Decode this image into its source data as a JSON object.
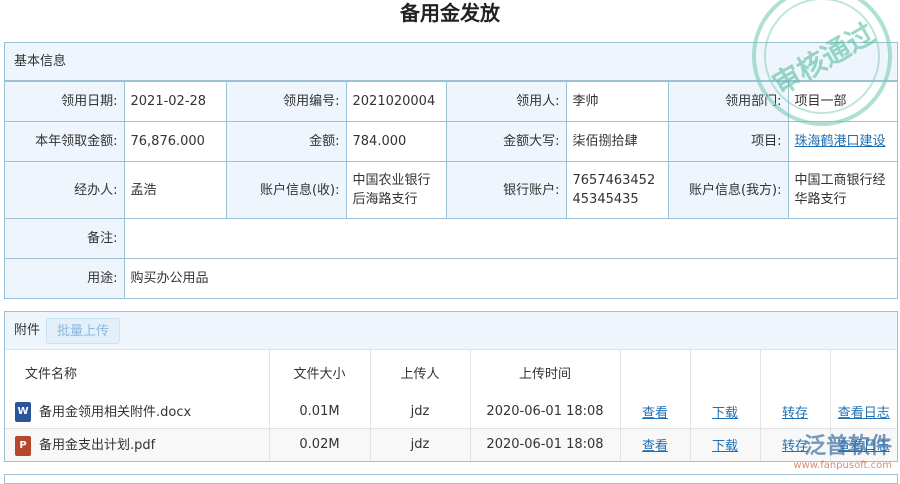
{
  "title": "备用金发放",
  "stamp": "审核通过",
  "watermark": {
    "brand": "泛普软件",
    "url": "www.fanpusoft.com"
  },
  "basic": {
    "header": "基本信息",
    "rows": [
      [
        {
          "l": "领用日期:",
          "v": "2021-02-28"
        },
        {
          "l": "领用编号:",
          "v": "2021020004"
        },
        {
          "l": "领用人:",
          "v": "李帅"
        },
        {
          "l": "领用部门:",
          "v": "项目一部"
        }
      ],
      [
        {
          "l": "本年领取金额:",
          "v": "76,876.000"
        },
        {
          "l": "金额:",
          "v": "784.000"
        },
        {
          "l": "金额大写:",
          "v": "柒佰捌拾肆"
        },
        {
          "l": "项目:",
          "v": "珠海鹤港口建设"
        }
      ],
      [
        {
          "l": "经办人:",
          "v": "孟浩"
        },
        {
          "l": "账户信息(收):",
          "v": "中国农业银行后海路支行"
        },
        {
          "l": "银行账户:",
          "v": "765746345245345435"
        },
        {
          "l": "账户信息(我方):",
          "v": "中国工商银行经华路支行"
        }
      ]
    ],
    "remark_label": "备注:",
    "remark": "",
    "purpose_label": "用途:",
    "purpose": "购买办公用品"
  },
  "attach": {
    "header": "附件",
    "upload_btn": "批量上传",
    "columns": [
      "文件名称",
      "文件大小",
      "上传人",
      "上传时间"
    ],
    "files": [
      {
        "icon": "word-icon",
        "name": "备用金领用相关附件.docx",
        "size": "0.01M",
        "user": "jdz",
        "time": "2020-06-01 18:08",
        "view": "查看",
        "download": "下载",
        "save": "转存",
        "log": "查看日志"
      },
      {
        "icon": "pdf-icon",
        "name": "备用金支出计划.pdf",
        "size": "0.02M",
        "user": "jdz",
        "time": "2020-06-01 18:08",
        "view": "查看",
        "download": "下载",
        "save": "转存",
        "log": "查看日志"
      }
    ]
  }
}
